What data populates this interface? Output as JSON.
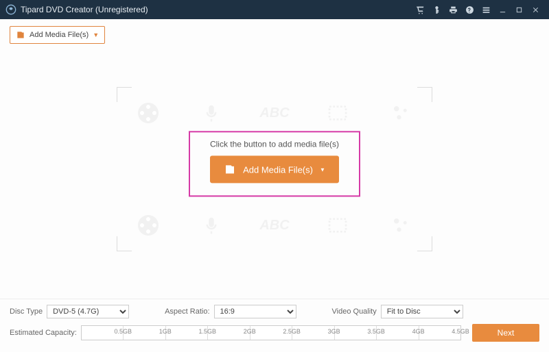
{
  "titlebar": {
    "app": "Tipard DVD Creator (Unregistered)"
  },
  "toolbar": {
    "add": "Add Media File(s)"
  },
  "drop": {
    "hint": "Click the button to add media file(s)",
    "button": "Add Media File(s)",
    "abc": "ABC"
  },
  "bottom": {
    "discTypeLabel": "Disc Type",
    "discType": "DVD-5 (4.7G)",
    "aspectLabel": "Aspect Ratio:",
    "aspect": "16:9",
    "qualityLabel": "Video Quality",
    "quality": "Fit to Disc",
    "capacityLabel": "Estimated Capacity:",
    "ticks": [
      "0.5GB",
      "1GB",
      "1.5GB",
      "2GB",
      "2.5GB",
      "3GB",
      "3.5GB",
      "4GB",
      "4.5GB"
    ],
    "next": "Next"
  }
}
